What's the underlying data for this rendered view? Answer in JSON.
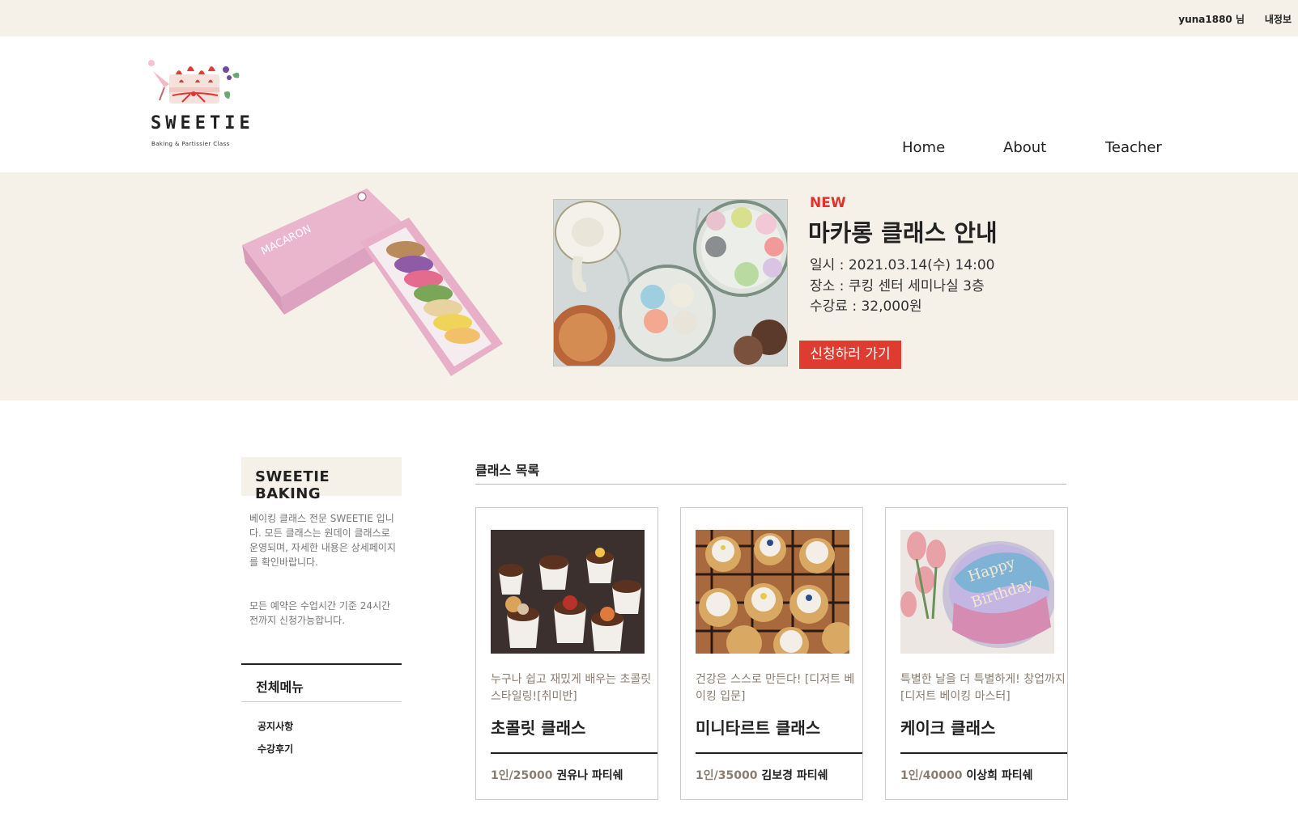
{
  "topbar": {
    "user": "yuna1880 님",
    "myinfo": "내정보"
  },
  "logo": {
    "brand": "SWEETIE",
    "sub": "Baking  & Partissier Class"
  },
  "nav": {
    "home": "Home",
    "about": "About",
    "teacher": "Teacher"
  },
  "banner": {
    "box_label": "MACARON",
    "new": "NEW",
    "title": "마카롱 클래스 안내",
    "date": "일시 : 2021.03.14(수) 14:00",
    "place": "장소 : 쿠킹 센터 세미나실 3층",
    "fee": "수강료 : 32,000원",
    "apply": "신청하러 가기"
  },
  "sidebar": {
    "heading": "SWEETIE BAKING",
    "intro": "베이킹 클래스 전문 SWEETIE 입니다. 모든 클래스는 원데이 클래스로 운영되며, 자세한 내용은 상세페이지를 확인바랍니다.",
    "notice": "모든 예약은 수업시간 기준 24시간 전까지 신청가능합니다.",
    "menu_title": "전체메뉴",
    "menu": [
      "공지사항",
      "수강후기"
    ]
  },
  "classes": {
    "title": "클래스 목록",
    "items": [
      {
        "desc": "누구나 쉽고 재밌게 배우는 초콜릿 스타일링![취미반]",
        "name": "초콜릿 클래스",
        "price": "1인/25000",
        "teacher": "권유나 파티쉐"
      },
      {
        "desc": "건강은 스스로 만든다! [디저트 베이킹 입문]",
        "name": "미니타르트 클래스",
        "price": "1인/35000",
        "teacher": "김보경 파티쉐"
      },
      {
        "desc": "특별한 날을 더 특별하게! 창업까지 [디저트 베이킹 마스터]",
        "name": "케이크 클래스",
        "price": "1인/40000",
        "teacher": "이상희 파티쉐"
      }
    ]
  },
  "colors": {
    "cream": "#f5f0e8",
    "accent_red": "#de3b31",
    "muted_brown": "#8a7c6f"
  }
}
